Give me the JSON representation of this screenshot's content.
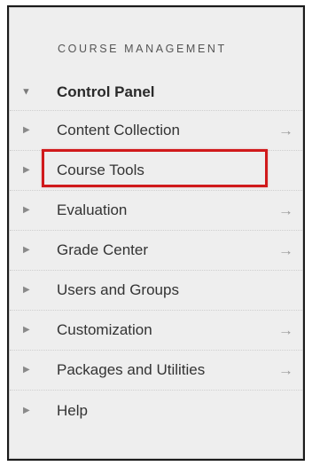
{
  "section_header": "COURSE MANAGEMENT",
  "control_panel": {
    "label": "Control Panel",
    "expanded": true
  },
  "items": [
    {
      "label": "Content Collection",
      "arrow": "→"
    },
    {
      "label": "Course Tools",
      "highlighted": true
    },
    {
      "label": "Evaluation",
      "arrow": "→"
    },
    {
      "label": "Grade Center",
      "arrow": "→"
    },
    {
      "label": "Users and Groups"
    },
    {
      "label": "Customization",
      "arrow": "→"
    },
    {
      "label": "Packages and Utilities",
      "arrow": "→"
    },
    {
      "label": "Help"
    }
  ],
  "icons": {
    "expanded_caret": "caret-down-icon",
    "collapsed_caret": "caret-right-icon",
    "submenu_arrow": "arrow-right-icon"
  },
  "colors": {
    "panel_bg": "#eeeeee",
    "highlight_border": "#d0191b",
    "text": "#333333"
  }
}
